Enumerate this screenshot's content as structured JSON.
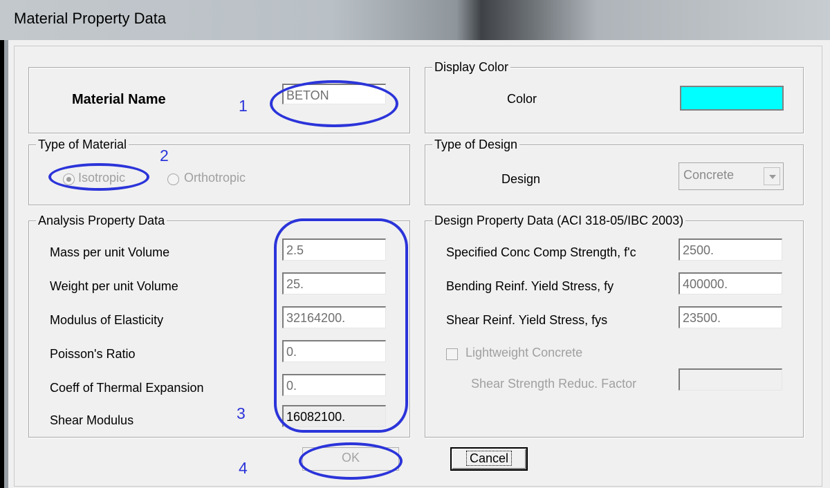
{
  "window": {
    "title": "Material Property Data"
  },
  "material_name": {
    "label": "Material Name",
    "value": "BETON"
  },
  "display_color": {
    "legend": "Display Color",
    "color_label": "Color",
    "color": "#00FFFF"
  },
  "type_of_material": {
    "legend": "Type of Material",
    "options": [
      {
        "label": "Isotropic",
        "selected": true
      },
      {
        "label": "Orthotropic",
        "selected": false
      }
    ]
  },
  "type_of_design": {
    "legend": "Type of Design",
    "design_label": "Design",
    "design_value": "Concrete"
  },
  "analysis": {
    "legend": "Analysis Property Data",
    "rows": [
      {
        "label": "Mass per unit Volume",
        "value": "2.5"
      },
      {
        "label": "Weight per unit Volume",
        "value": "25."
      },
      {
        "label": "Modulus of Elasticity",
        "value": "32164200."
      },
      {
        "label": "Poisson's Ratio",
        "value": "0."
      },
      {
        "label": "Coeff of Thermal Expansion",
        "value": "0."
      },
      {
        "label": "Shear Modulus",
        "value": "16082100."
      }
    ]
  },
  "design_data": {
    "legend": "Design Property Data (ACI 318-05/IBC 2003)",
    "rows": [
      {
        "label": "Specified Conc Comp Strength, f'c",
        "value": "2500."
      },
      {
        "label": "Bending Reinf. Yield Stress, fy",
        "value": "400000."
      },
      {
        "label": "Shear Reinf. Yield Stress, fys",
        "value": "23500."
      }
    ],
    "lightweight_label": "Lightweight Concrete",
    "shear_reduc_label": "Shear Strength Reduc. Factor",
    "shear_reduc_value": ""
  },
  "buttons": {
    "ok": "OK",
    "cancel": "Cancel"
  },
  "annotations": {
    "n1": "1",
    "n2": "2",
    "n3": "3",
    "n4": "4",
    "color": "#2B34D9"
  }
}
